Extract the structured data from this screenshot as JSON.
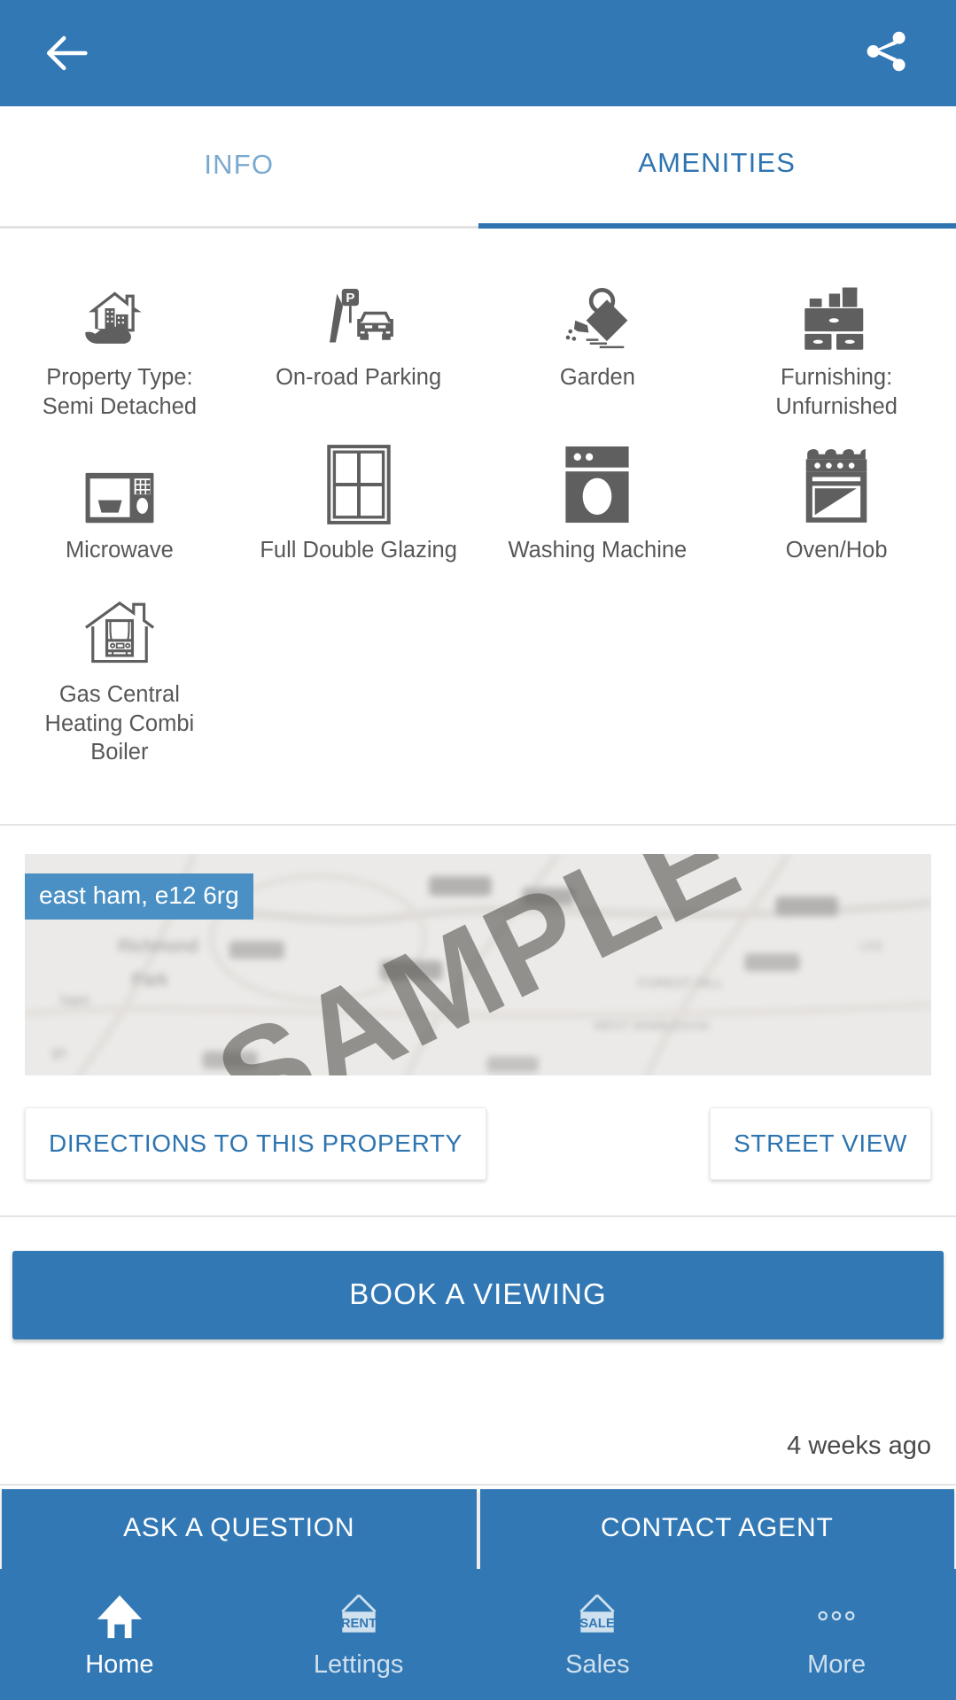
{
  "appbar": {
    "back_icon": "arrow-left-icon",
    "share_icon": "share-icon",
    "background": "#3278b4"
  },
  "tabs": [
    {
      "label": "INFO",
      "active": false
    },
    {
      "label": "AMENITIES",
      "active": true
    }
  ],
  "amenities": [
    {
      "label": "Property Type: Semi Detached",
      "icon": "house-in-hand-icon"
    },
    {
      "label": "On-road Parking",
      "icon": "parking-sign-car-icon"
    },
    {
      "label": "Garden",
      "icon": "watering-can-icon"
    },
    {
      "label": "Furnishing: Unfurnished",
      "icon": "dresser-icon"
    },
    {
      "label": "Microwave",
      "icon": "microwave-icon"
    },
    {
      "label": "Full Double Glazing",
      "icon": "window-icon"
    },
    {
      "label": "Washing Machine",
      "icon": "washing-machine-icon"
    },
    {
      "label": "Oven/Hob",
      "icon": "oven-hob-icon"
    },
    {
      "label": "Gas Central Heating Combi Boiler",
      "icon": "house-boiler-icon"
    }
  ],
  "map": {
    "location_badge": "east ham, e12 6rg",
    "watermark": "SAMPLE",
    "badge_color": "#4a90c4",
    "directions_label": "DIRECTIONS TO THIS PROPERTY",
    "street_view_label": "STREET VIEW"
  },
  "actions": {
    "book_viewing_label": "BOOK A VIEWING",
    "timestamp": "4 weeks ago",
    "ask_question_label": "ASK A QUESTION",
    "contact_agent_label": "CONTACT AGENT"
  },
  "bottom_nav": [
    {
      "label": "Home",
      "icon": "home-icon",
      "active": true
    },
    {
      "label": "Lettings",
      "icon": "rent-sign-icon",
      "active": false
    },
    {
      "label": "Sales",
      "icon": "sale-sign-icon",
      "active": false
    },
    {
      "label": "More",
      "icon": "more-dots-icon",
      "active": false
    }
  ]
}
